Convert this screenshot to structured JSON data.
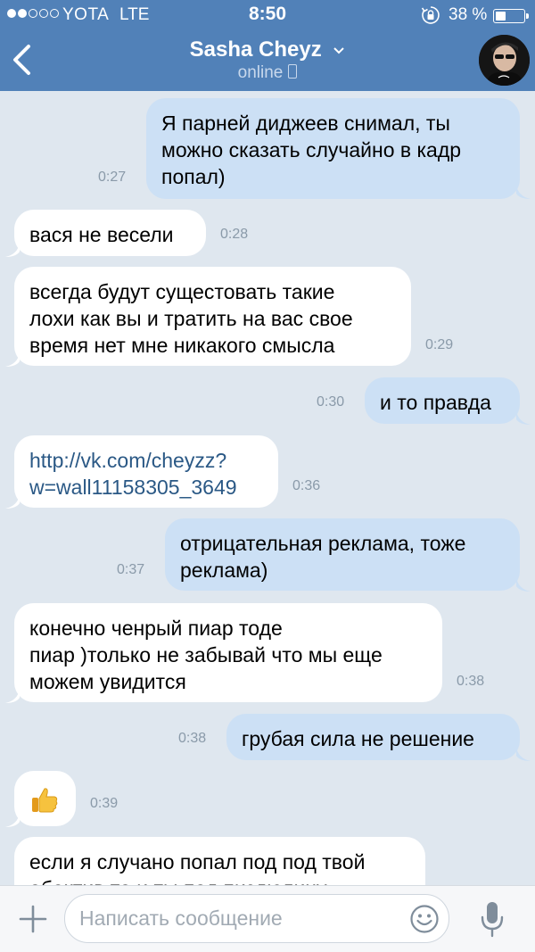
{
  "status_bar": {
    "carrier": "YOTA",
    "network": "LTE",
    "time": "8:50",
    "battery": "38 %",
    "battery_level": 0.38,
    "signal_bars": 2,
    "signal_total": 5
  },
  "header": {
    "title": "Sasha Cheyz",
    "status": "online",
    "colors": {
      "bar": "#5181b8",
      "outgoing_bubble": "#cce0f5",
      "incoming_bubble": "#ffffff",
      "link": "#2a5885"
    }
  },
  "messages": [
    {
      "direction": "out",
      "lines": [
        "Я парней диджеев снимал, ты",
        "можно сказать случайно в кадр",
        "попал)"
      ],
      "time": "0:27"
    },
    {
      "direction": "in",
      "lines": [
        "вася не весели"
      ],
      "time": "0:28"
    },
    {
      "direction": "in",
      "lines": [
        "всегда будут сущестовать такие",
        "лохи как вы и тратить на вас свое",
        "время нет мне никакого смысла"
      ],
      "time": "0:29"
    },
    {
      "direction": "out",
      "lines": [
        "и то правда"
      ],
      "time": "0:30"
    },
    {
      "direction": "in",
      "lines": [
        "http://vk.com/cheyzz?",
        "w=wall11158305_3649"
      ],
      "time": "0:36",
      "link": true
    },
    {
      "direction": "out",
      "lines": [
        "отрицательная реклама, тоже",
        "реклама)"
      ],
      "time": "0:37"
    },
    {
      "direction": "in",
      "lines": [
        "конечно ченрый пиар тоде",
        "пиар )только не забывай что мы еще",
        "можем увидится"
      ],
      "time": "0:38"
    },
    {
      "direction": "out",
      "lines": [
        "грубая сила не решение"
      ],
      "time": "0:38"
    },
    {
      "direction": "in",
      "lines": [],
      "time": "0:39",
      "sticker": "thumbs-up"
    },
    {
      "direction": "in",
      "lines": [
        "если я случано попал под под твой",
        "обектив то и ты под пиздюлину"
      ],
      "time": ""
    }
  ],
  "composer": {
    "placeholder": "Написать сообщение",
    "icons": [
      "plus-icon",
      "emoji-icon",
      "microphone-icon"
    ]
  }
}
